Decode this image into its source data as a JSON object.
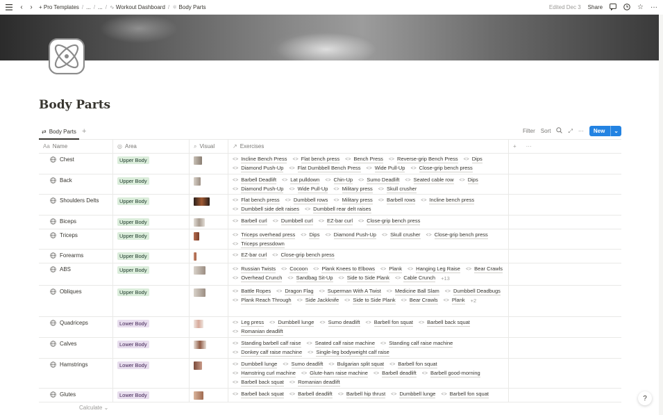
{
  "topbar": {
    "menu_icon": "menu-icon",
    "breadcrumbs": [
      {
        "label": "Pro Templates",
        "prefix": "+"
      },
      {
        "label": "..."
      },
      {
        "label": "..."
      },
      {
        "label": "Workout Dashboard"
      },
      {
        "label": "Body Parts"
      }
    ],
    "edited": "Edited Dec 3",
    "share": "Share"
  },
  "page": {
    "title": "Body Parts"
  },
  "database": {
    "view_tab": "Body Parts",
    "tools": {
      "filter": "Filter",
      "sort": "Sort",
      "new": "New"
    },
    "columns": {
      "name": "Name",
      "area": "Area",
      "visual": "Visual",
      "exercises": "Exercises"
    },
    "calculate": "Calculate",
    "tag_colors": {
      "Upper Body": "#dbeddb",
      "Lower Body": "#e8deee"
    },
    "rows": [
      {
        "name": "Chest",
        "area": "Upper Body",
        "height": 30,
        "exercises": [
          "Incline Bench Press",
          "Flat bench press",
          "Bench Press",
          "Reverse-grip Bench Press",
          "Dips",
          "Diamond Push-Up",
          "Flat Dumbbell Bench Press",
          "Wide Pull-Up",
          "Close-grip bench press"
        ],
        "more": ""
      },
      {
        "name": "Back",
        "area": "Upper Body",
        "height": 29,
        "exercises": [
          "Barbell Deadlift",
          "Lat pulldown",
          "Chin-Up",
          "Sumo Deadlift",
          "Seated cable row",
          "Dips",
          "Diamond Push-Up",
          "Wide Pull-Up",
          "Military press",
          "Skull crusher"
        ],
        "more": ""
      },
      {
        "name": "Shoulders Delts",
        "area": "Upper Body",
        "height": 30,
        "exercises": [
          "Flat bench press",
          "Dumbbell rows",
          "Military press",
          "Barbell rows",
          "Incline bench press",
          "Dumbbell side delt raises",
          "Dumbbell rear delt raises"
        ],
        "more": ""
      },
      {
        "name": "Biceps",
        "area": "Upper Body",
        "height": 20,
        "exercises": [
          "Barbell curl",
          "Dumbbell curl",
          "EZ-bar curl",
          "Close-grip bench press"
        ],
        "more": ""
      },
      {
        "name": "Triceps",
        "area": "Upper Body",
        "height": 29,
        "exercises": [
          "Triceps overhead press",
          "Dips",
          "Diamond Push-Up",
          "Skull crusher",
          "Close-grip bench press",
          "Triceps pressdown"
        ],
        "more": ""
      },
      {
        "name": "Forearms",
        "area": "Upper Body",
        "height": 20,
        "exercises": [
          "EZ-bar curl",
          "Close-grip bench press"
        ],
        "more": ""
      },
      {
        "name": "ABS",
        "area": "Upper Body",
        "height": 32,
        "exercises": [
          "Russian Twists",
          "Cocoon",
          "Plank Knees to Elbows",
          "Plank",
          "Hanging Leg Raise",
          "Bear Crawls",
          "Overhead Crunch",
          "Sandbag Sit-Up",
          "Side to Side Plank",
          "Cable Crunch"
        ],
        "more": "+13"
      },
      {
        "name": "Obliques",
        "area": "Upper Body",
        "height": 45,
        "exercises": [
          "Battle Ropes",
          "Dragon Flag",
          "Superman With A Twist",
          "Medicine Ball Slam",
          "Dumbbell Deadbugs",
          "Plank Reach Through",
          "Side Jackknife",
          "Side to Side Plank",
          "Bear Crawls",
          "Plank"
        ],
        "more": "+2"
      },
      {
        "name": "Quadriceps",
        "area": "Lower Body",
        "height": 30,
        "exercises": [
          "Leg press",
          "Dumbbell lunge",
          "Sumo deadlift",
          "Barbell fon squat",
          "Barbell back squat",
          "Romanian deadlift"
        ],
        "more": ""
      },
      {
        "name": "Calves",
        "area": "Lower Body",
        "height": 30,
        "exercises": [
          "Standing barbell calf raise",
          "Seated calf raise machine",
          "Standing calf raise machine",
          "Donkey calf raise machine",
          "Single-leg bodyweight calf raise"
        ],
        "more": ""
      },
      {
        "name": "Hamstrings",
        "area": "Lower Body",
        "height": 43,
        "exercises": [
          "Dumbbell lunge",
          "Sumo deadlift",
          "Bulgarian split squat",
          "Barbell fon squat",
          "Hamstring curl machine",
          "Glute-ham raise machine",
          "Barbell deadlift",
          "Barbell good-morning",
          "Barbell back squat",
          "Romanian deadlift"
        ],
        "more": ""
      },
      {
        "name": "Glutes",
        "area": "Lower Body",
        "height": 20,
        "exercises": [
          "Barbell back squat",
          "Barbell deadlift",
          "Barbell hip thrust",
          "Dumbbell lunge",
          "Barbell fon squat"
        ],
        "more": ""
      }
    ]
  },
  "help": "?"
}
